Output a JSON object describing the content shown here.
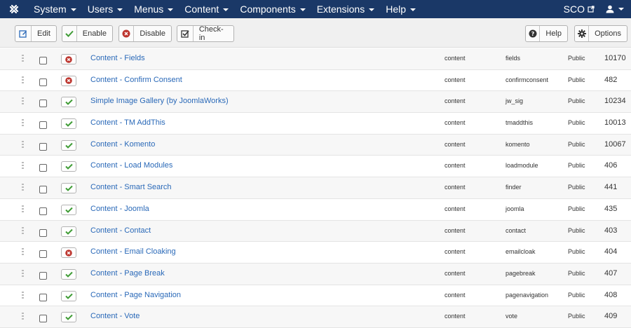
{
  "navbar": {
    "menu": [
      {
        "label": "System"
      },
      {
        "label": "Users"
      },
      {
        "label": "Menus"
      },
      {
        "label": "Content"
      },
      {
        "label": "Components"
      },
      {
        "label": "Extensions"
      },
      {
        "label": "Help"
      }
    ],
    "site_label": "SCO",
    "icons": {
      "logo": "joomla-logo-icon",
      "site": "external-link-icon",
      "user": "user-icon"
    }
  },
  "toolbar": {
    "edit_label": "Edit",
    "enable_label": "Enable",
    "disable_label": "Disable",
    "checkin_label": "Check-in",
    "help_label": "Help",
    "options_label": "Options"
  },
  "colors": {
    "navbar": "#1a3867",
    "link": "#2a69b8",
    "enabled": "#3f9c35",
    "disabled": "#bd362f"
  },
  "plugins": [
    {
      "name": "Content - Fields",
      "enabled": false,
      "folder": "content",
      "element": "fields",
      "access": "Public",
      "id": "10170"
    },
    {
      "name": "Content - Confirm Consent",
      "enabled": false,
      "folder": "content",
      "element": "confirmconsent",
      "access": "Public",
      "id": "482"
    },
    {
      "name": "Simple Image Gallery (by JoomlaWorks)",
      "enabled": true,
      "folder": "content",
      "element": "jw_sig",
      "access": "Public",
      "id": "10234"
    },
    {
      "name": "Content - TM AddThis",
      "enabled": true,
      "folder": "content",
      "element": "tmaddthis",
      "access": "Public",
      "id": "10013"
    },
    {
      "name": "Content - Komento",
      "enabled": true,
      "folder": "content",
      "element": "komento",
      "access": "Public",
      "id": "10067"
    },
    {
      "name": "Content - Load Modules",
      "enabled": true,
      "folder": "content",
      "element": "loadmodule",
      "access": "Public",
      "id": "406"
    },
    {
      "name": "Content - Smart Search",
      "enabled": true,
      "folder": "content",
      "element": "finder",
      "access": "Public",
      "id": "441"
    },
    {
      "name": "Content - Joomla",
      "enabled": true,
      "folder": "content",
      "element": "joomla",
      "access": "Public",
      "id": "435"
    },
    {
      "name": "Content - Contact",
      "enabled": true,
      "folder": "content",
      "element": "contact",
      "access": "Public",
      "id": "403"
    },
    {
      "name": "Content - Email Cloaking",
      "enabled": false,
      "folder": "content",
      "element": "emailcloak",
      "access": "Public",
      "id": "404"
    },
    {
      "name": "Content - Page Break",
      "enabled": true,
      "folder": "content",
      "element": "pagebreak",
      "access": "Public",
      "id": "407"
    },
    {
      "name": "Content - Page Navigation",
      "enabled": true,
      "folder": "content",
      "element": "pagenavigation",
      "access": "Public",
      "id": "408"
    },
    {
      "name": "Content - Vote",
      "enabled": true,
      "folder": "content",
      "element": "vote",
      "access": "Public",
      "id": "409"
    }
  ]
}
